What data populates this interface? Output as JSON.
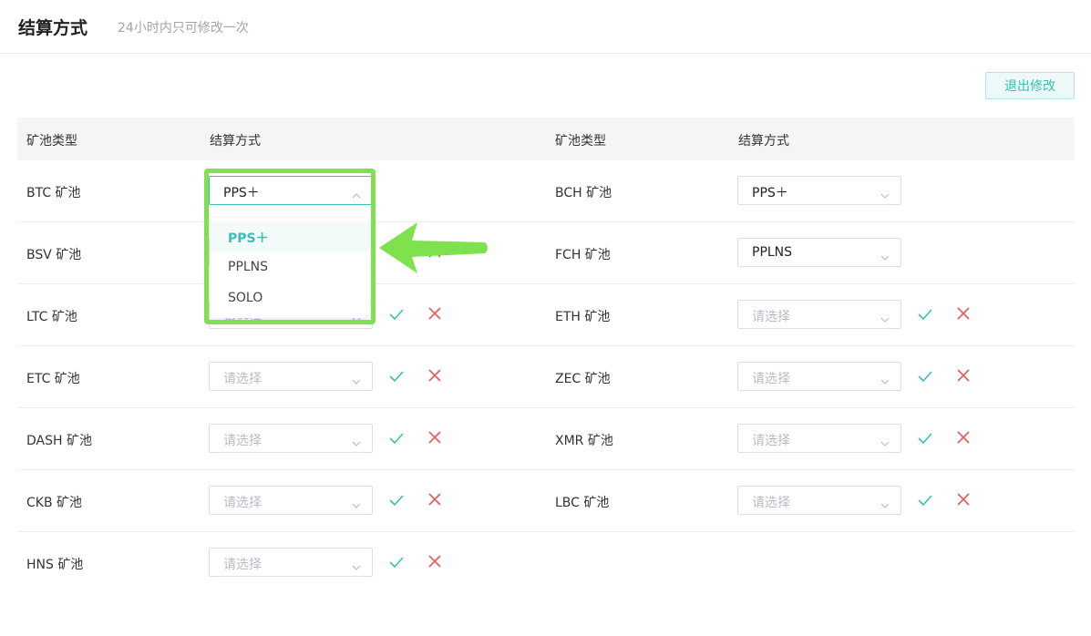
{
  "header": {
    "title": "结算方式",
    "subtitle": "24小时内只可修改一次"
  },
  "exit_button": "退出修改",
  "columns": {
    "pool_type": "矿池类型",
    "settlement": "结算方式"
  },
  "placeholder": "请选择",
  "left_rows": [
    {
      "pool": "BTC 矿池",
      "value": "PPS＋",
      "open": true
    },
    {
      "pool": "BSV 矿池",
      "value": ""
    },
    {
      "pool": "LTC 矿池",
      "value": ""
    },
    {
      "pool": "ETC 矿池",
      "value": ""
    },
    {
      "pool": "DASH 矿池",
      "value": ""
    },
    {
      "pool": "CKB 矿池",
      "value": ""
    },
    {
      "pool": "HNS 矿池",
      "value": ""
    }
  ],
  "right_rows": [
    {
      "pool": "BCH 矿池",
      "value": "PPS＋"
    },
    {
      "pool": "FCH 矿池",
      "value": "PPLNS"
    },
    {
      "pool": "ETH 矿池",
      "value": ""
    },
    {
      "pool": "ZEC 矿池",
      "value": ""
    },
    {
      "pool": "XMR 矿池",
      "value": ""
    },
    {
      "pool": "LBC 矿池",
      "value": ""
    }
  ],
  "dropdown_options": [
    "PPS＋",
    "PPLNS",
    "SOLO"
  ],
  "dropdown_selected": "PPS＋",
  "colors": {
    "accent": "#3dbdb6",
    "cancel": "#e55a5a",
    "highlight": "#7ee14d"
  }
}
